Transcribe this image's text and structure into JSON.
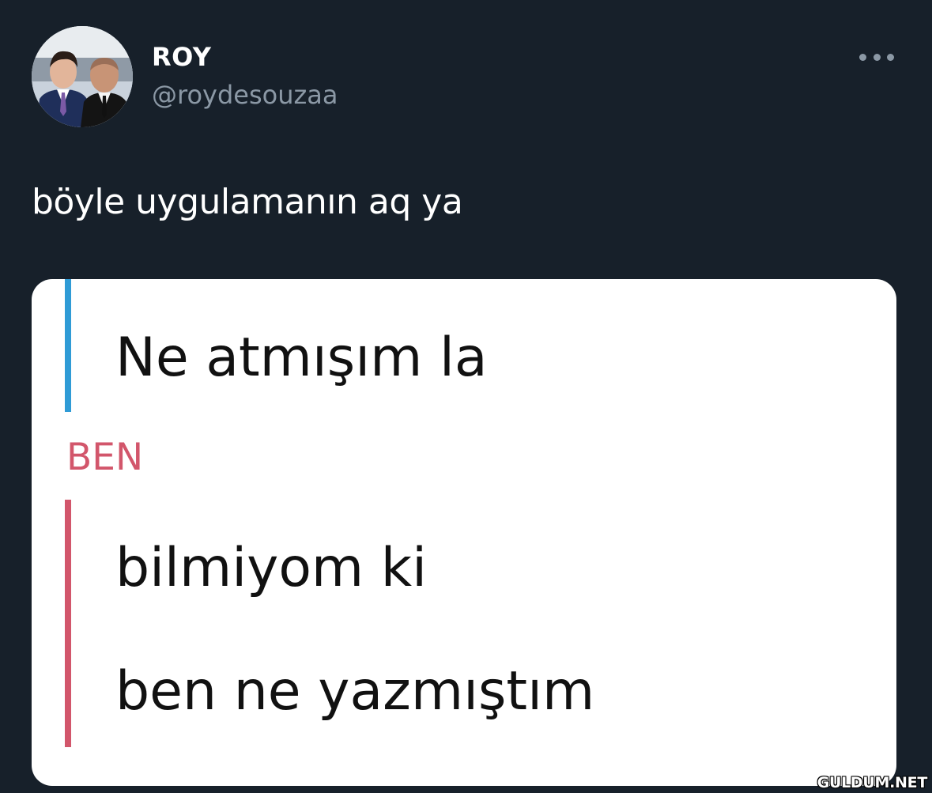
{
  "author": {
    "display_name": "ROY",
    "handle": "@roydesouzaa",
    "avatar_icon": "profile-photo-avatar"
  },
  "menu": {
    "icon": "more-options-icon"
  },
  "tweet": {
    "text": "böyle uygulamanın aq ya"
  },
  "media": {
    "quoted_message": "Ne atmışım la",
    "reply_sender": "BEN",
    "reply_line_1": "bilmiyom ki",
    "reply_line_2": "ben ne yazmıştım",
    "colors": {
      "quote_bar": "#2f9bd6",
      "reply_bar": "#d2566b",
      "sender_label": "#d2566b"
    }
  },
  "watermark": "GULDUM.NET",
  "colors": {
    "background": "#17202a",
    "text_primary": "#ffffff",
    "text_secondary": "#8b98a5"
  }
}
